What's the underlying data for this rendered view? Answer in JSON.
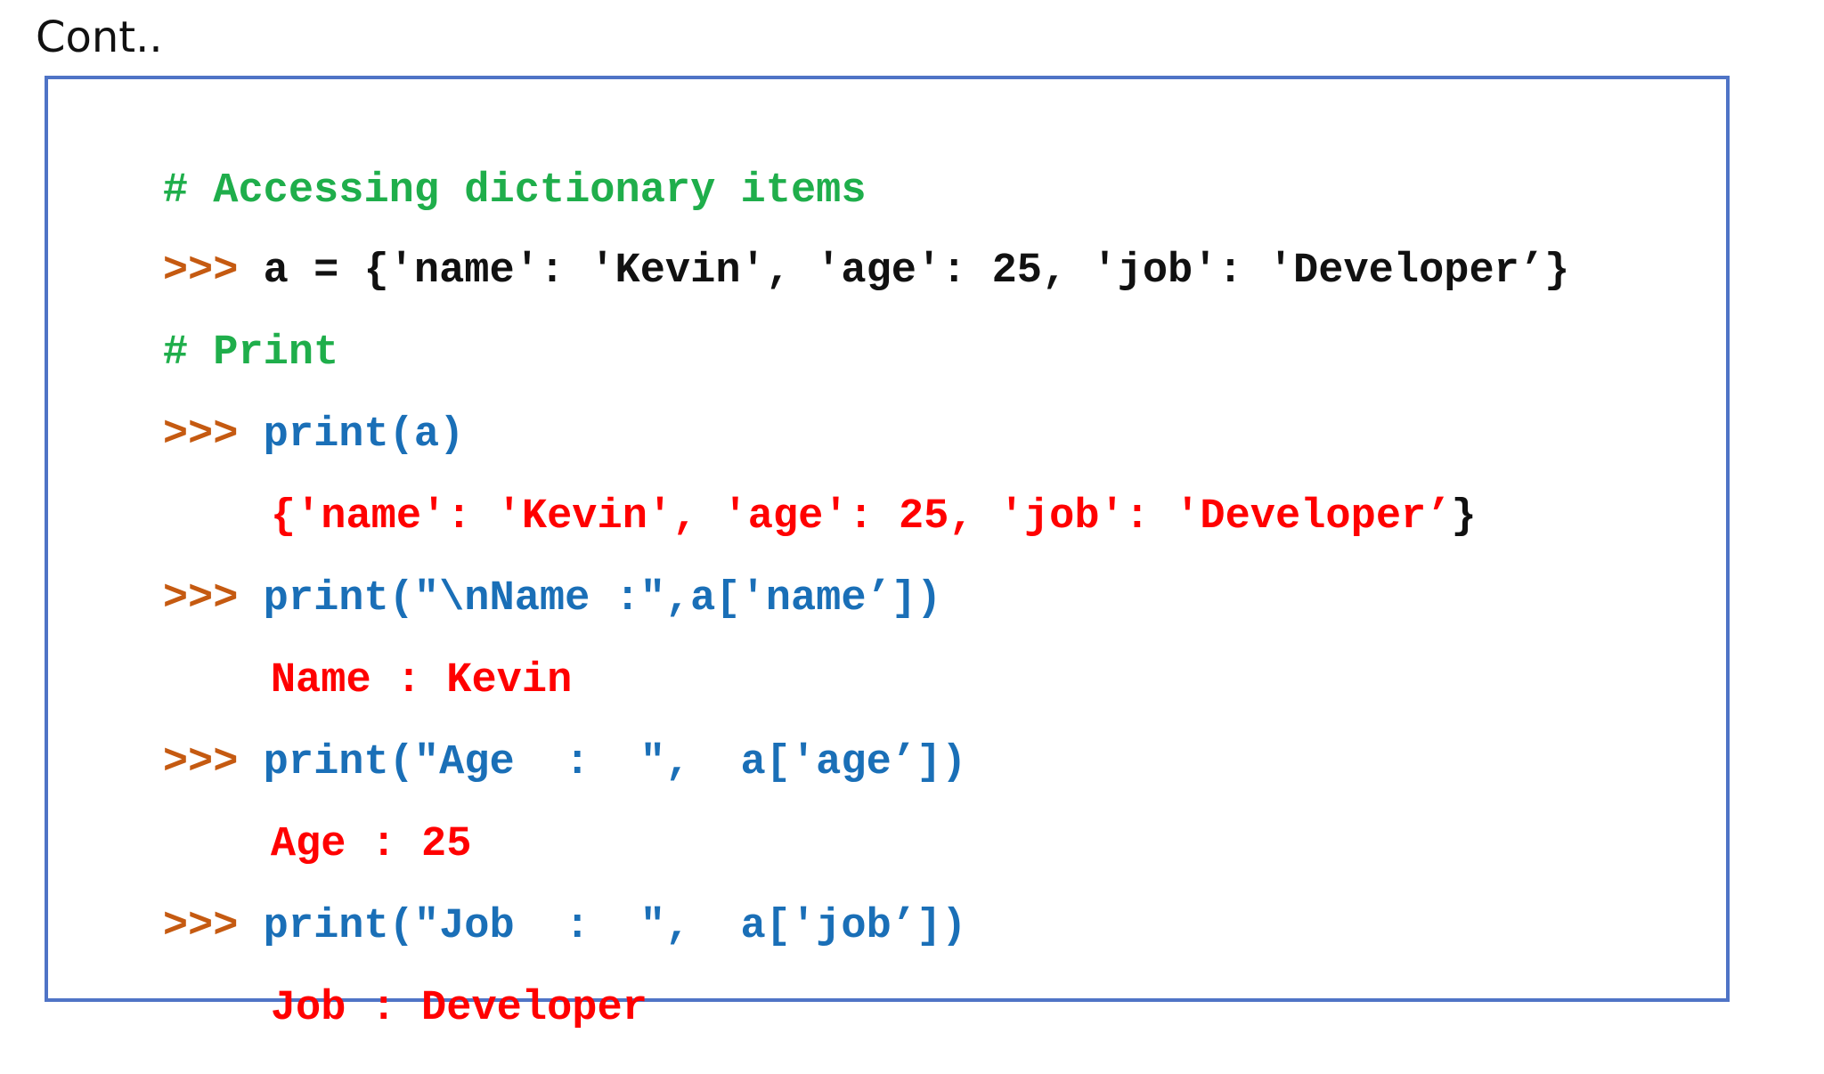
{
  "title": "Cont..",
  "colors": {
    "border": "#4f74c6",
    "comment": "#1fae4b",
    "prompt": "#c55a11",
    "code": "#111111",
    "call": "#1a6fb7",
    "output": "#ff0000"
  },
  "lines": [
    {
      "prompt": "",
      "text": "# Accessing dictionary items",
      "tail": ""
    },
    {
      "prompt": ">>> ",
      "text": "a = {'name': 'Kevin', 'age': 25, 'job': 'Developer’}",
      "tail": ""
    },
    {
      "prompt": "",
      "text": "# Print",
      "tail": ""
    },
    {
      "prompt": ">>> ",
      "text": "print(a)",
      "tail": ""
    },
    {
      "prompt": "",
      "text": "{'name': 'Kevin', 'age': 25, 'job': 'Developer’",
      "tail": "}"
    },
    {
      "prompt": ">>> ",
      "text": "print(\"\\nName :\",a['name’])",
      "tail": ""
    },
    {
      "prompt": "",
      "text": "Name : Kevin",
      "tail": ""
    },
    {
      "prompt": ">>> ",
      "text": "print(\"Age  :  \",  a['age’])",
      "tail": ""
    },
    {
      "prompt": "",
      "text": "Age : 25",
      "tail": ""
    },
    {
      "prompt": ">>> ",
      "text": "print(\"Job  :  \",  a['job’])",
      "tail": ""
    },
    {
      "prompt": "",
      "text": "Job : Developer",
      "tail": ""
    }
  ]
}
